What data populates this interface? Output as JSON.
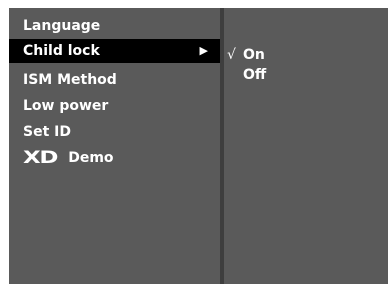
{
  "menu": {
    "items": [
      {
        "label": "Language",
        "selected": false
      },
      {
        "label": "Child lock",
        "selected": true,
        "has_submenu": true
      },
      {
        "label": "ISM Method",
        "selected": false
      },
      {
        "label": "Low power",
        "selected": false
      },
      {
        "label": "Set ID",
        "selected": false
      },
      {
        "label": "Demo",
        "selected": false,
        "logo_text": "XD"
      }
    ],
    "submenu_arrow": "▶"
  },
  "submenu": {
    "options": [
      {
        "label": "On",
        "checked": true,
        "check_mark": "√"
      },
      {
        "label": "Off",
        "checked": false
      }
    ]
  },
  "colors": {
    "panel": "#5a5a5a",
    "divider": "#3e3e3e",
    "highlight": "#000000",
    "text": "#ffffff"
  }
}
